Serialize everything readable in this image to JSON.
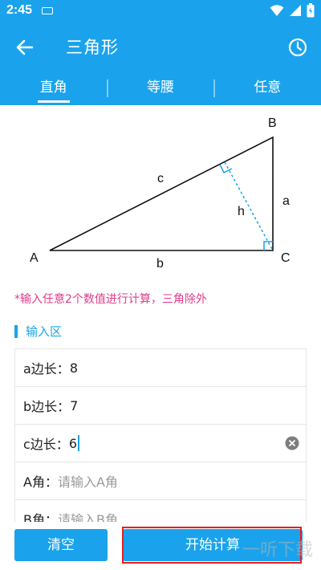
{
  "status_bar": {
    "time": "2:45"
  },
  "toolbar": {
    "title": "三角形"
  },
  "tabs": [
    {
      "label": "直角"
    },
    {
      "label": "等腰"
    },
    {
      "label": "任意"
    }
  ],
  "diagram": {
    "vertex_a": "A",
    "vertex_b": "B",
    "vertex_c": "C",
    "side_a": "a",
    "side_b": "b",
    "side_c": "c",
    "height": "h"
  },
  "note": "*输入任意2个数值进行计算，三角除外",
  "section_title": "输入区",
  "fields": [
    {
      "label": "a边长：",
      "value": "8",
      "placeholder": ""
    },
    {
      "label": "b边长：",
      "value": "7",
      "placeholder": ""
    },
    {
      "label": "c边长：",
      "value": "6",
      "placeholder": ""
    },
    {
      "label": "A角：",
      "value": "",
      "placeholder": "请输入A角"
    },
    {
      "label": "B角：",
      "value": "",
      "placeholder": "请输入B角"
    }
  ],
  "buttons": {
    "clear": "清空",
    "calculate": "开始计算"
  },
  "watermark": "一听下载",
  "colors": {
    "primary": "#1aa3ec",
    "note": "#e23b8c",
    "highlight": "#e01f26"
  }
}
